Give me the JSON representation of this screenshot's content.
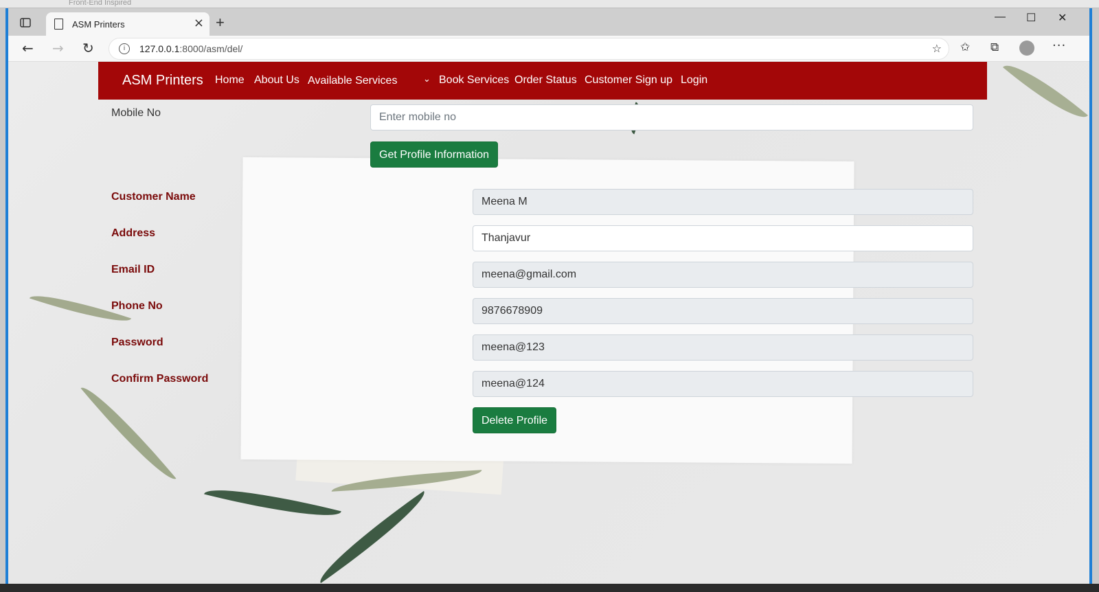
{
  "browser": {
    "background_window_title": "Front-End Inspired",
    "tab_title": "ASM Printers",
    "url_host": "127.0.0.1",
    "url_rest": ":8000/asm/del/"
  },
  "navbar": {
    "brand": "ASM Printers",
    "links": [
      "Home",
      "About Us",
      "Available Services",
      "Book Services",
      "Order Status",
      "Customer Sign up",
      "Login"
    ],
    "color": "#a30708"
  },
  "search": {
    "label": "Mobile No",
    "placeholder": "Enter mobile no",
    "button": "Get Profile Information"
  },
  "profile": {
    "customer_name_label": "Customer Name",
    "customer_name": "Meena M",
    "address_label": "Address",
    "address": "Thanjavur",
    "email_label": "Email ID",
    "email": "meena@gmail.com",
    "phone_label": "Phone No",
    "phone": "9876678909",
    "password_label": "Password",
    "password": "meena@123",
    "confirm_password_label": "Confirm Password",
    "confirm_password": "meena@124",
    "delete_button": "Delete Profile"
  },
  "colors": {
    "button_green": "#1a7c40",
    "label_maroon": "#7a0a0a",
    "window_border": "#1e7fd6"
  }
}
